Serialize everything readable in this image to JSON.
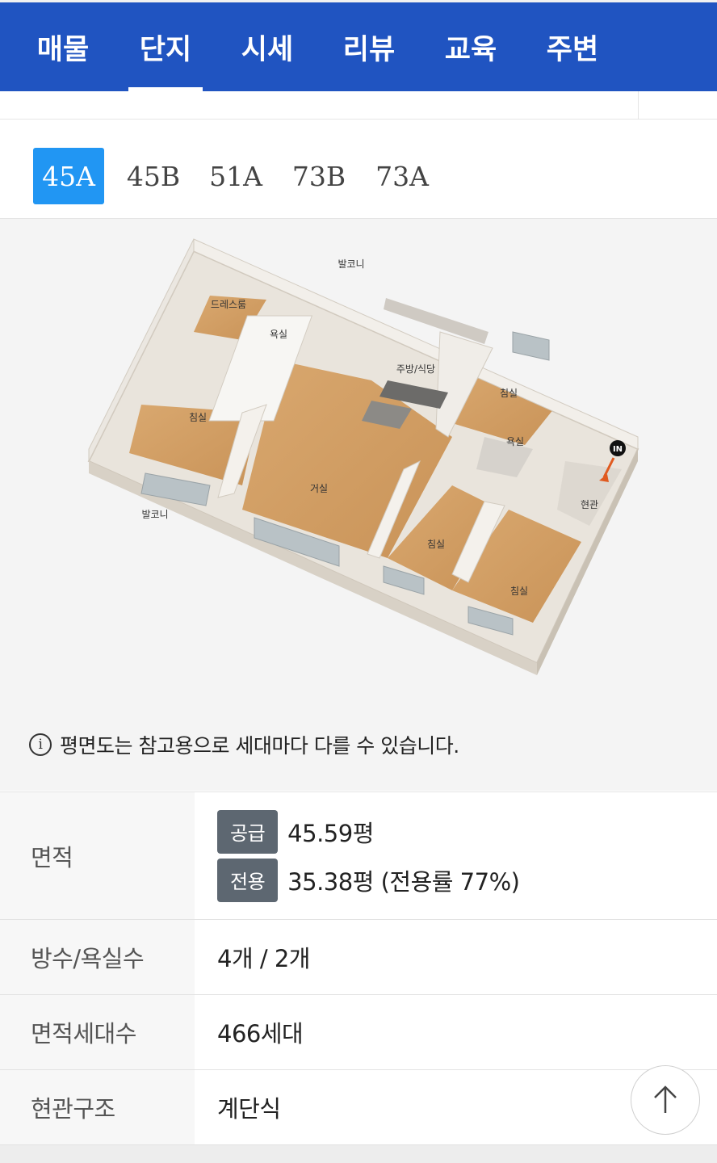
{
  "nav": {
    "tabs": [
      {
        "label": "매물"
      },
      {
        "label": "단지"
      },
      {
        "label": "시세"
      },
      {
        "label": "리뷰"
      },
      {
        "label": "교육"
      },
      {
        "label": "주변"
      }
    ],
    "active": "단지"
  },
  "types": {
    "items": [
      "45A",
      "45B",
      "51A",
      "73B",
      "73A"
    ],
    "selected": "45A",
    "accent_color": "#2196f3"
  },
  "floorplan": {
    "rooms": {
      "dressroom": "드레스룸",
      "bath1": "욕실",
      "kitchen": "주방/식당",
      "bed1": "침실",
      "bed2": "침실",
      "bath2": "욕실",
      "in_marker": "IN",
      "living": "거실",
      "entrance": "현관",
      "balcony_top": "발코니",
      "balcony_left": "발코니",
      "bed3": "침실",
      "bed4": "침실"
    },
    "notice": "평면도는 참고용으로 세대마다 다를 수 있습니다."
  },
  "info": {
    "area_label": "면적",
    "supply_chip": "공급",
    "supply_value": "45.59평",
    "exclusive_chip": "전용",
    "exclusive_value": "35.38평 (전용률 77%)",
    "rooms_label": "방수/욕실수",
    "rooms_value": "4개 / 2개",
    "households_label": "면적세대수",
    "households_value": "466세대",
    "entrance_label": "현관구조",
    "entrance_value": "계단식"
  },
  "colors": {
    "nav_bg": "#2054c1",
    "chip_bg": "#5d6771"
  },
  "icons": {
    "info": "info-circle-icon",
    "scroll_top": "arrow-up-icon"
  }
}
